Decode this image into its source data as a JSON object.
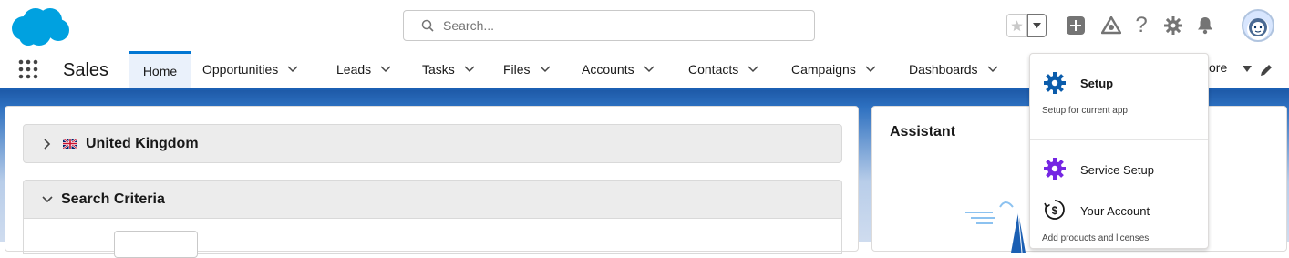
{
  "header": {
    "search_placeholder": "Search...",
    "icons": [
      "cloud-logo",
      "search-icon",
      "favorites-star-icon",
      "favorites-menu-icon",
      "global-actions-icon",
      "trailhead-icon",
      "help-icon",
      "setup-gear-icon",
      "notifications-bell-icon",
      "user-avatar"
    ]
  },
  "nav": {
    "app_name": "Sales",
    "tabs": [
      {
        "label": "Home",
        "active": true
      },
      {
        "label": "Opportunities"
      },
      {
        "label": "Leads"
      },
      {
        "label": "Tasks"
      },
      {
        "label": "Files"
      },
      {
        "label": "Accounts"
      },
      {
        "label": "Contacts"
      },
      {
        "label": "Campaigns"
      },
      {
        "label": "Dashboards"
      }
    ],
    "more_label": "ore"
  },
  "main": {
    "section1_title": "United Kingdom",
    "section2_title": "Search Criteria"
  },
  "assistant": {
    "title": "Assistant"
  },
  "setup_menu": {
    "setup_label": "Setup",
    "setup_sub": "Setup for current app",
    "service_setup_label": "Service Setup",
    "your_account_label": "Your Account",
    "your_account_sub": "Add products and licenses"
  },
  "colors": {
    "brand_blue": "#0176d3",
    "nav_border": "#1b5fb3",
    "logo": "#00a1e0",
    "setup_icon": "#0b5cab",
    "service_setup_icon": "#7526e3"
  }
}
